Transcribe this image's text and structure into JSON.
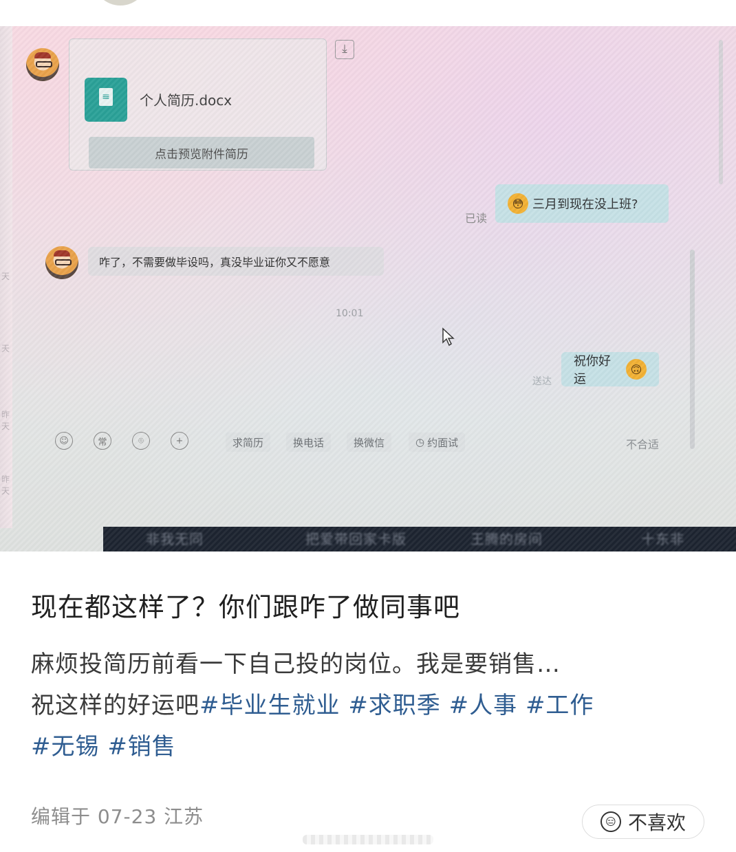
{
  "photo": {
    "file_card": {
      "file_name": "个人简历.docx",
      "preview_label": "点击预览附件简历",
      "download_icon": "⤓"
    },
    "messages": {
      "read_status": "已读",
      "question": "三月到现在没上班?",
      "question_emoji": "😳",
      "reply": "咋了，不需要做毕设吗，真没毕业证你又不愿意",
      "timestamp": "10:01",
      "delivered_status": "送达",
      "wish": "祝你好运",
      "wish_emoji": "🙃"
    },
    "toolbar": {
      "emoji_icon": "☺",
      "phrases_icon": "常",
      "location_icon": "⌾",
      "plus_icon": "+",
      "request_resume": "求简历",
      "exchange_phone": "换电话",
      "exchange_wechat": "换微信",
      "interview_icon": "◷",
      "schedule_interview": "约面试",
      "not_suitable": "不合适"
    },
    "sidebar_fragments": [
      "天",
      "天",
      "昨天",
      "昨天"
    ],
    "taskbar": [
      "非我无同",
      "把爱带回家卡版",
      "王腾的房间",
      "十东非"
    ]
  },
  "post": {
    "title": "现在都这样了？你们跟咋了做同事吧",
    "body_line1": "麻烦投简历前看一下自己投的岗位。我是要销售…",
    "body_line2_prefix": "祝这样的好运吧",
    "hashtags": [
      "#毕业生就业",
      "#求职季",
      "#人事",
      "#工作",
      "#无锡",
      "#销售"
    ],
    "meta": "编辑于 07-23 江苏",
    "dislike_label": "不喜欢",
    "dislike_icon": "😑"
  }
}
